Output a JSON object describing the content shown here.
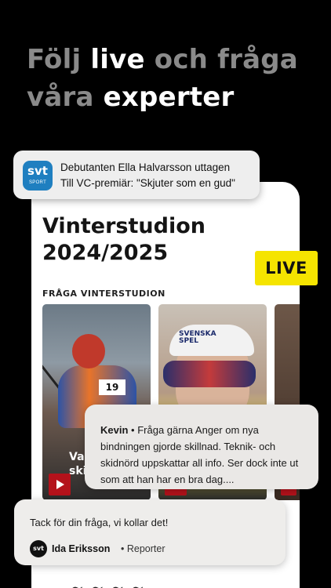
{
  "headline": {
    "line1_part1": "Följ",
    "line1_part2": "live",
    "line1_part3": "och fråga",
    "line2_part1": "våra",
    "line2_part2": "experter"
  },
  "phone": {
    "title_line1": "Vinterstudion",
    "title_line2": "2024/2025",
    "section_label": "FRÅGA VINTERSTUDION",
    "card1_overlay": "Va\nskidå",
    "card1_bib": "19",
    "card2_band_text": "SVENSKA\nSPEL"
  },
  "live_badge": "LIVE",
  "notification": {
    "app_icon": "svt",
    "app_icon_sub": "SPORT",
    "title": "Debutanten Ella Halvarsson uttagen",
    "body": "Till VC-premiär: \"Skjuter som en gud\""
  },
  "comment": {
    "author": "Kevin",
    "separator": "•",
    "text": "Fråga gärna Anger om nya bindningen gjorde skillnad. Teknik- och skidnörd uppskattar all info. Ser dock inte ut som att han har en bra dag...."
  },
  "reply": {
    "text": "Tack för din fråga, vi kollar det!",
    "avatar": "svt",
    "name": "Ida Eriksson",
    "role": "• Reporter"
  },
  "colors": {
    "background": "#000000",
    "live_yellow": "#f5e400",
    "svt_blue": "#1f7fc0",
    "play_red": "#b4121b"
  }
}
